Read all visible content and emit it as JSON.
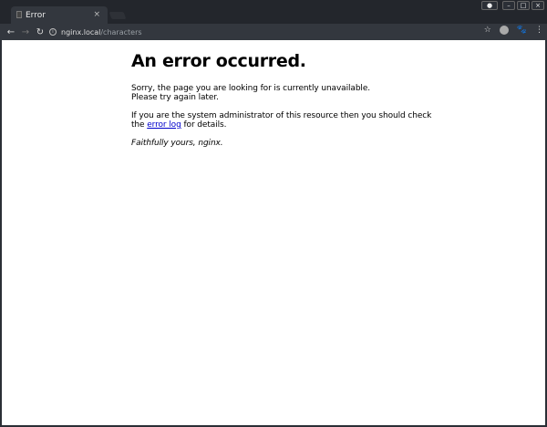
{
  "browser": {
    "tab_title": "Error",
    "tab_close": "×",
    "url_host": "nginx.local",
    "url_path": "/characters",
    "window_buttons": {
      "minimize": "–",
      "maximize": "□",
      "close": "×"
    }
  },
  "page": {
    "heading": "An error occurred.",
    "p1_line1": "Sorry, the page you are looking for is currently unavailable.",
    "p1_line2": "Please try again later.",
    "p2_before": "If you are the system administrator of this resource then you should check the ",
    "p2_link": "error log",
    "p2_after": " for details.",
    "signature": "Faithfully yours, nginx."
  }
}
